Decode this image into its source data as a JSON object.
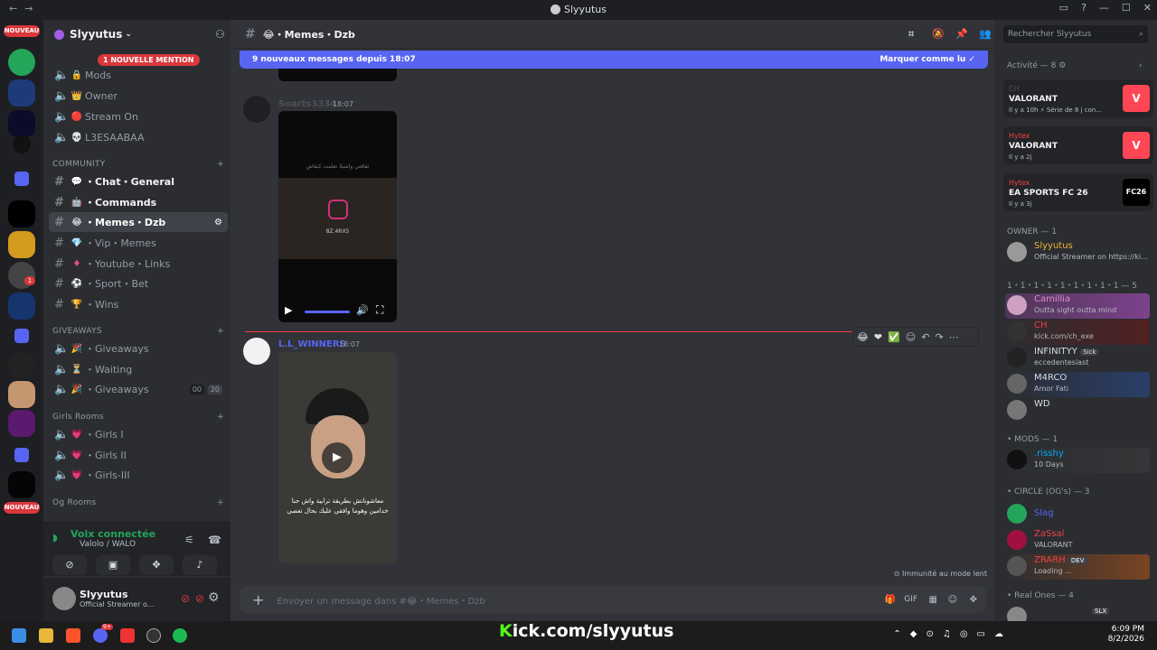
{
  "window": {
    "title": "Slyyutus"
  },
  "servers": {
    "badge_new": "NOUVEAU",
    "badge_new_bottom": "NOUVEAU",
    "notif_count": "1"
  },
  "guild": {
    "name": "Slyyutus",
    "mention_pill": "1 NOUVELLE MENTION",
    "top_channels": [
      {
        "emoji": "🔒",
        "label": "Mods"
      },
      {
        "emoji": "👑",
        "label": "Owner"
      },
      {
        "emoji": "🔴",
        "label": "Stream On"
      },
      {
        "emoji": "💀",
        "label": "L3ESAABAA"
      }
    ],
    "category_community": "COMMUNITY",
    "community_channels": [
      {
        "emoji": "💬",
        "label": "・Chat・General"
      },
      {
        "emoji": "🤖",
        "label": "・Commands"
      },
      {
        "emoji": "😂",
        "label": "・Memes・Dzb"
      },
      {
        "emoji": "💎",
        "label": "・Vip・Memes"
      },
      {
        "emoji": "♦",
        "label": "・Youtube・Links"
      },
      {
        "emoji": "⚽",
        "label": "・Sport・Bet"
      },
      {
        "emoji": "🏆",
        "label": "・Wins"
      }
    ],
    "category_giveaways": "GIVEAWAYS",
    "giveaway_channels": [
      {
        "emoji": "🎉",
        "label": "・Giveaways"
      },
      {
        "emoji": "⏳",
        "label": "・Waiting"
      },
      {
        "emoji": "🎉",
        "label": "・Giveaways"
      }
    ],
    "voice_counts": [
      "00",
      "20"
    ],
    "category_girls": "Girls Rooms",
    "girls_channels": [
      {
        "emoji": "💗",
        "label": "・Girls I"
      },
      {
        "emoji": "💗",
        "label": "・Girls II"
      },
      {
        "emoji": "💗",
        "label": "・Girls-III"
      }
    ],
    "category_og": "Og Rooms"
  },
  "voice": {
    "status": "Voix connectée",
    "server": "Valolo / WALO"
  },
  "user": {
    "name": "Slyyutus",
    "status": "Official Streamer o..."
  },
  "channel": {
    "name": "😂・Memes・Dzb",
    "new_messages": "9 nouveaux messages depuis 18:07",
    "mark_read": "Marquer comme lu",
    "slowmode": "Immunité au mode lent",
    "composer_placeholder": "Envoyer un message dans #😂・Memes・Dzb"
  },
  "messages": [
    {
      "author": "Soarts3334",
      "time": "18:07",
      "video_text": "ثقافتي واشيلا تعلمت كيفاش",
      "handle": "8Z.4RX5",
      "author_color": "#4e5058"
    },
    {
      "author": "L.L_WINNERS",
      "time": "18:07",
      "author_color": "#5865f2",
      "caption": "معاشوناتش بطريقة ترابية واش حنا خدامين وهوما وافقي عليك بحال تعصي"
    }
  ],
  "members": {
    "search_placeholder": "Rechercher Slyyutus",
    "activity_header": "Activité — 8",
    "activities": [
      {
        "user": "CH",
        "game": "VALORANT",
        "meta": "Il y a 10h",
        "extra": "Série de 8 j con..."
      },
      {
        "user": "Hytex",
        "game": "VALORANT",
        "meta": "Il y a 2j"
      },
      {
        "user": "Hytex",
        "game": "EA SPORTS FC 26",
        "meta": "Il y a 3j",
        "icon": "FC26"
      }
    ],
    "owner_header": "OWNER — 1",
    "owner": {
      "name": "Slyyutus",
      "status": "Official Streamer on https://ki..."
    },
    "group_header": "1・1・1・1・1・1・1・1・1 — 5",
    "group": [
      {
        "name": "Camillia",
        "status": "Outta sight outta mind",
        "color": "#e38bd0"
      },
      {
        "name": "CH",
        "status": "kick.com/ch_exe",
        "color": "#ed4245"
      },
      {
        "name": "INFINITYY",
        "status": "eccedentesiast",
        "tag": "Sick",
        "color": "#dbdee1"
      },
      {
        "name": "M4RCO",
        "status": "Amor Fati",
        "color": "#dbdee1"
      },
      {
        "name": "WD",
        "status": "",
        "color": "#dbdee1"
      }
    ],
    "mods_header": "• MODS — 1",
    "mod": {
      "name": ".risshy",
      "status": "10 Days"
    },
    "circle_header": "• CIRCLE (OG's) — 3",
    "circle": [
      {
        "name": "Slag",
        "status": "",
        "color": "#5865f2"
      },
      {
        "name": "ZaSsal",
        "status": "VALORANT",
        "color": "#ed4245"
      },
      {
        "name": "ZRARH",
        "status": "Loading ...",
        "tag": "DEV",
        "color": "#ed4245"
      }
    ],
    "realones_header": "• Real Ones — 4",
    "realone_tag": "SLX"
  },
  "taskbar": {
    "kick": "kick.com/slyyutus",
    "kick_k": "K",
    "time": "6:09 PM",
    "date": "8/2/2026",
    "discord_badge": "9+"
  }
}
